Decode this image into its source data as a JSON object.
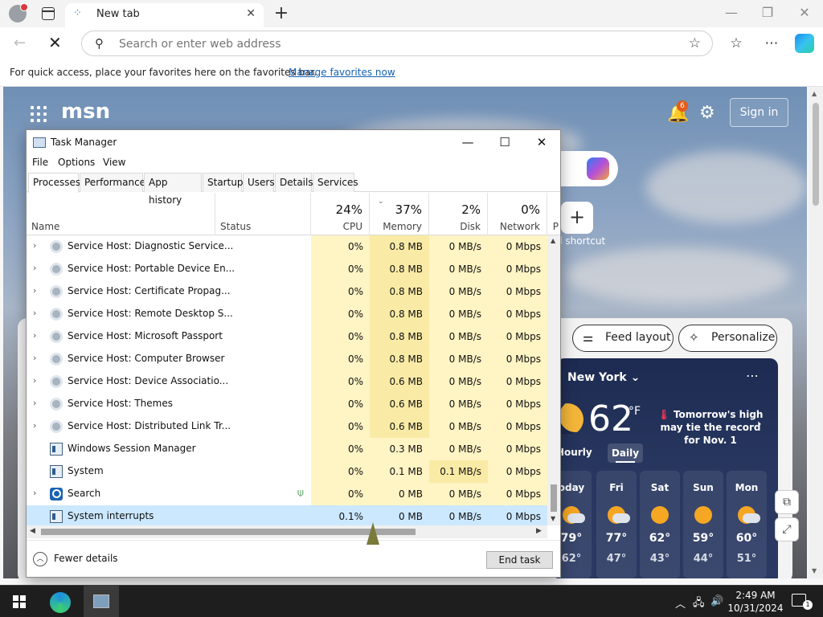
{
  "browser": {
    "tab_title": "New tab",
    "address_placeholder": "Search or enter web address",
    "favorites_message": "For quick access, place your favorites here on the favorites bar.",
    "favorites_link": "Manage favorites now"
  },
  "msn": {
    "logo": "msn",
    "notification_count": "6",
    "sign_in": "Sign in",
    "add_shortcut": "d shortcut",
    "feed_layout": "Feed layout",
    "personalize": "Personalize"
  },
  "weather": {
    "city": "New York",
    "temp": "62",
    "unit": "°F",
    "alert": "Tomorrow's high may tie the record for Nov. 1",
    "hourly": "Hourly",
    "daily": "Daily",
    "days": [
      {
        "name": "oday",
        "high": "79°",
        "low": "62°",
        "icon": "partly-cloudy"
      },
      {
        "name": "Fri",
        "high": "77°",
        "low": "47°",
        "icon": "partly-cloudy"
      },
      {
        "name": "Sat",
        "high": "62°",
        "low": "43°",
        "icon": "sunny"
      },
      {
        "name": "Sun",
        "high": "59°",
        "low": "44°",
        "icon": "sunny"
      },
      {
        "name": "Mon",
        "high": "60°",
        "low": "51°",
        "icon": "partly-cloudy"
      }
    ]
  },
  "taskmanager": {
    "title": "Task Manager",
    "menu": [
      "File",
      "Options",
      "View"
    ],
    "tabs": [
      "Processes",
      "Performance",
      "App history",
      "Startup",
      "Users",
      "Details",
      "Services"
    ],
    "columns": {
      "name": "Name",
      "status": "Status",
      "cpu_pct": "24%",
      "cpu": "CPU",
      "mem_pct": "37%",
      "mem": "Memory",
      "disk_pct": "2%",
      "disk": "Disk",
      "net_pct": "0%",
      "net": "Network",
      "extra": "P"
    },
    "rows": [
      {
        "name": "Service Host: Diagnostic Service...",
        "cpu": "0%",
        "mem": "0.8 MB",
        "disk": "0 MB/s",
        "net": "0 Mbps"
      },
      {
        "name": "Service Host: Portable Device En...",
        "cpu": "0%",
        "mem": "0.8 MB",
        "disk": "0 MB/s",
        "net": "0 Mbps"
      },
      {
        "name": "Service Host: Certificate Propag...",
        "cpu": "0%",
        "mem": "0.8 MB",
        "disk": "0 MB/s",
        "net": "0 Mbps"
      },
      {
        "name": "Service Host: Remote Desktop S...",
        "cpu": "0%",
        "mem": "0.8 MB",
        "disk": "0 MB/s",
        "net": "0 Mbps"
      },
      {
        "name": "Service Host: Microsoft Passport",
        "cpu": "0%",
        "mem": "0.8 MB",
        "disk": "0 MB/s",
        "net": "0 Mbps"
      },
      {
        "name": "Service Host: Computer Browser",
        "cpu": "0%",
        "mem": "0.8 MB",
        "disk": "0 MB/s",
        "net": "0 Mbps"
      },
      {
        "name": "Service Host: Device Associatio...",
        "cpu": "0%",
        "mem": "0.6 MB",
        "disk": "0 MB/s",
        "net": "0 Mbps"
      },
      {
        "name": "Service Host: Themes",
        "cpu": "0%",
        "mem": "0.6 MB",
        "disk": "0 MB/s",
        "net": "0 Mbps"
      },
      {
        "name": "Service Host: Distributed Link Tr...",
        "cpu": "0%",
        "mem": "0.6 MB",
        "disk": "0 MB/s",
        "net": "0 Mbps"
      },
      {
        "name": "Windows Session Manager",
        "cpu": "0%",
        "mem": "0.3 MB",
        "disk": "0 MB/s",
        "net": "0 Mbps"
      },
      {
        "name": "System",
        "cpu": "0%",
        "mem": "0.1 MB",
        "disk": "0.1 MB/s",
        "net": "0 Mbps"
      },
      {
        "name": "Search",
        "cpu": "0%",
        "mem": "0 MB",
        "disk": "0 MB/s",
        "net": "0 Mbps"
      },
      {
        "name": "System interrupts",
        "cpu": "0.1%",
        "mem": "0 MB",
        "disk": "0 MB/s",
        "net": "0 Mbps"
      }
    ],
    "fewer_details": "Fewer details",
    "end_task": "End task"
  },
  "taskbar": {
    "time": "2:49 AM",
    "date": "10/31/2024",
    "notifications": "1"
  }
}
